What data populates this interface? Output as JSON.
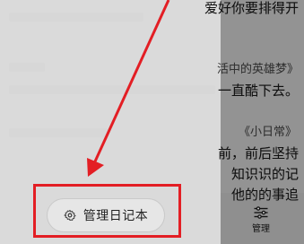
{
  "background": {
    "line1": "爱好你要排得开",
    "entry2_tag": "活中的英雄梦》",
    "entry2_text": "一直酷下去。",
    "entry3_tag": "《小日常》",
    "entry3_line1": "前，前后坚持",
    "entry3_line2": "知识识的记",
    "entry3_line3": "他的的事追"
  },
  "drawer": {
    "manage_button_label": "管理日记本",
    "manage_button_icon": "gear-icon"
  },
  "bottom_nav": {
    "manage_label": "管理",
    "manage_icon": "sliders-icon"
  },
  "annotation": {
    "color": "#e31e24"
  }
}
